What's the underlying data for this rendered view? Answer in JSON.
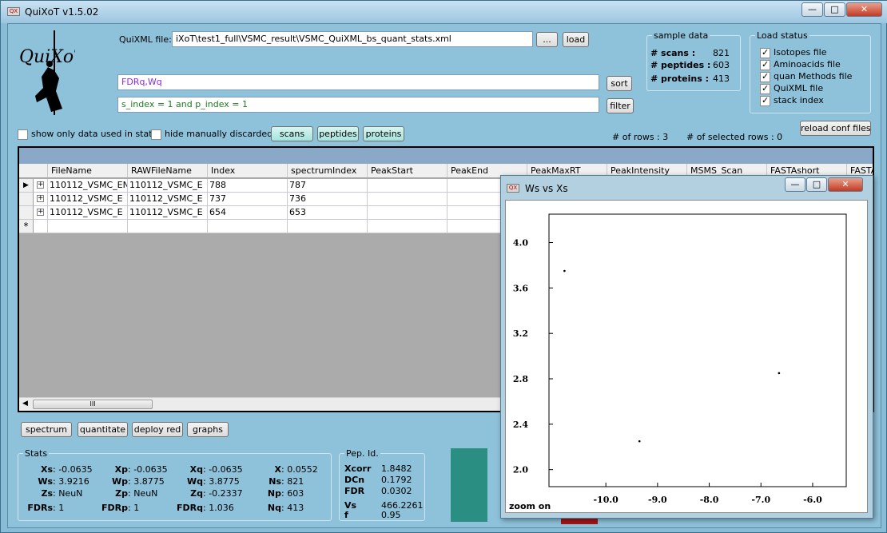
{
  "window": {
    "title": "QuiXoT v1.5.02",
    "app_icon": "QX"
  },
  "quixml": {
    "label": "QuiXML file:",
    "path": "iXoT\\test1_full\\VSMC_result\\VSMC_QuiXML_bs_quant_stats.xml",
    "browse_label": "...",
    "load_label": "load"
  },
  "logo": {
    "text": "QuiXoT"
  },
  "sort": {
    "value": "FDRq,Wq",
    "button": "sort"
  },
  "filter": {
    "value": "s_index = 1 and p_index = 1",
    "button": "filter"
  },
  "sample": {
    "title": "sample data",
    "rows": [
      {
        "label": "# scans :",
        "value": "821"
      },
      {
        "label": "# peptides :",
        "value": "603"
      },
      {
        "label": "# proteins :",
        "value": "413"
      }
    ]
  },
  "load_status": {
    "title": "Load status",
    "items": [
      {
        "label": "Isotopes file",
        "checked": true
      },
      {
        "label": "Aminoacids file",
        "checked": true
      },
      {
        "label": "quan Methods file",
        "checked": true
      },
      {
        "label": "QuiXML file",
        "checked": true
      },
      {
        "label": "stack index",
        "checked": true
      }
    ]
  },
  "options": {
    "show_only_used": "show only data used in stats",
    "hide_discarded": "hide manually discarded"
  },
  "toggles": {
    "scans": "scans",
    "peptides": "peptides",
    "proteins": "proteins"
  },
  "counts": {
    "rows": "# of rows :  3",
    "selected": "# of  selected rows :  0"
  },
  "reload_button": "reload conf files",
  "grid": {
    "columns": [
      "FileName",
      "RAWFileName",
      "Index",
      "spectrumIndex",
      "PeakStart",
      "PeakEnd",
      "PeakMaxRT",
      "PeakIntensity",
      "MSMS_Scan",
      "FASTAshort",
      "FASTA"
    ],
    "rows": [
      [
        "110112_VSMC_EN",
        "110112_VSMC_E",
        "788",
        "787"
      ],
      [
        "110112_VSMC_E",
        "110112_VSMC_E",
        "737",
        "736"
      ],
      [
        "110112_VSMC_E",
        "110112_VSMC_E",
        "654",
        "653"
      ]
    ],
    "new_row_marker": "*",
    "current_row_marker": "▶",
    "scroll_thumb_glyph": "III"
  },
  "bottom_buttons": {
    "spectrum": "spectrum",
    "quantitate": "quantitate",
    "deploy_red": "deploy red",
    "graphs": "graphs"
  },
  "stats": {
    "title": "Stats",
    "rows": [
      [
        {
          "k": "Xs",
          "v": ": -0.0635"
        },
        {
          "k": "Xp",
          "v": ": -0.0635"
        },
        {
          "k": "Xq",
          "v": ": -0.0635"
        },
        {
          "k": "X",
          "v": ": 0.0552"
        }
      ],
      [
        {
          "k": "Ws",
          "v": ": 3.9216"
        },
        {
          "k": "Wp",
          "v": ": 3.8775"
        },
        {
          "k": "Wq",
          "v": ": 3.8775"
        },
        {
          "k": "Ns",
          "v": ": 821"
        }
      ],
      [
        {
          "k": "Zs",
          "v": ": NeuN"
        },
        {
          "k": "Zp",
          "v": ": NeuN"
        },
        {
          "k": "Zq",
          "v": ": -0.2337"
        },
        {
          "k": "Np",
          "v": ": 603"
        }
      ],
      [
        {
          "k": "FDRs",
          "v": ": 1"
        },
        {
          "k": "FDRp",
          "v": ": 1"
        },
        {
          "k": "FDRq",
          "v": ": 1.036"
        },
        {
          "k": "Nq",
          "v": ": 413"
        }
      ]
    ]
  },
  "pepid": {
    "title": "Pep. Id.",
    "rows": [
      {
        "k": "Xcorr",
        "v": "1.8482"
      },
      {
        "k": "DCn",
        "v": "0.1792"
      },
      {
        "k": "FDR",
        "v": "0.0302"
      },
      {
        "k": "Vs",
        "v": "466.2261"
      },
      {
        "k": "f",
        "v": "0.95"
      }
    ]
  },
  "colors": {
    "teal_box": "#2a8f82",
    "red_bar": "#a31515",
    "accent_toggle": "#a6e3dc"
  },
  "plot_window": {
    "title": "Ws vs Xs",
    "zoom_label": "zoom on"
  },
  "chart_data": {
    "type": "scatter",
    "title": "Ws vs Xs",
    "xlim": [
      -11.1,
      -5.35
    ],
    "ylim": [
      1.85,
      4.25
    ],
    "xticks": [
      "-10.0",
      "-9.0",
      "-8.0",
      "-7.0",
      "-6.0"
    ],
    "yticks": [
      "4.0",
      "3.6",
      "3.2",
      "2.8",
      "2.4",
      "2.0"
    ],
    "xtick_values": [
      -10,
      -9,
      -8,
      -7,
      -6
    ],
    "ytick_values": [
      4.0,
      3.6,
      3.2,
      2.8,
      2.4,
      2.0
    ],
    "points": [
      {
        "x": -10.8,
        "y": 3.75
      },
      {
        "x": -9.35,
        "y": 2.25
      },
      {
        "x": -6.65,
        "y": 2.85
      }
    ]
  }
}
